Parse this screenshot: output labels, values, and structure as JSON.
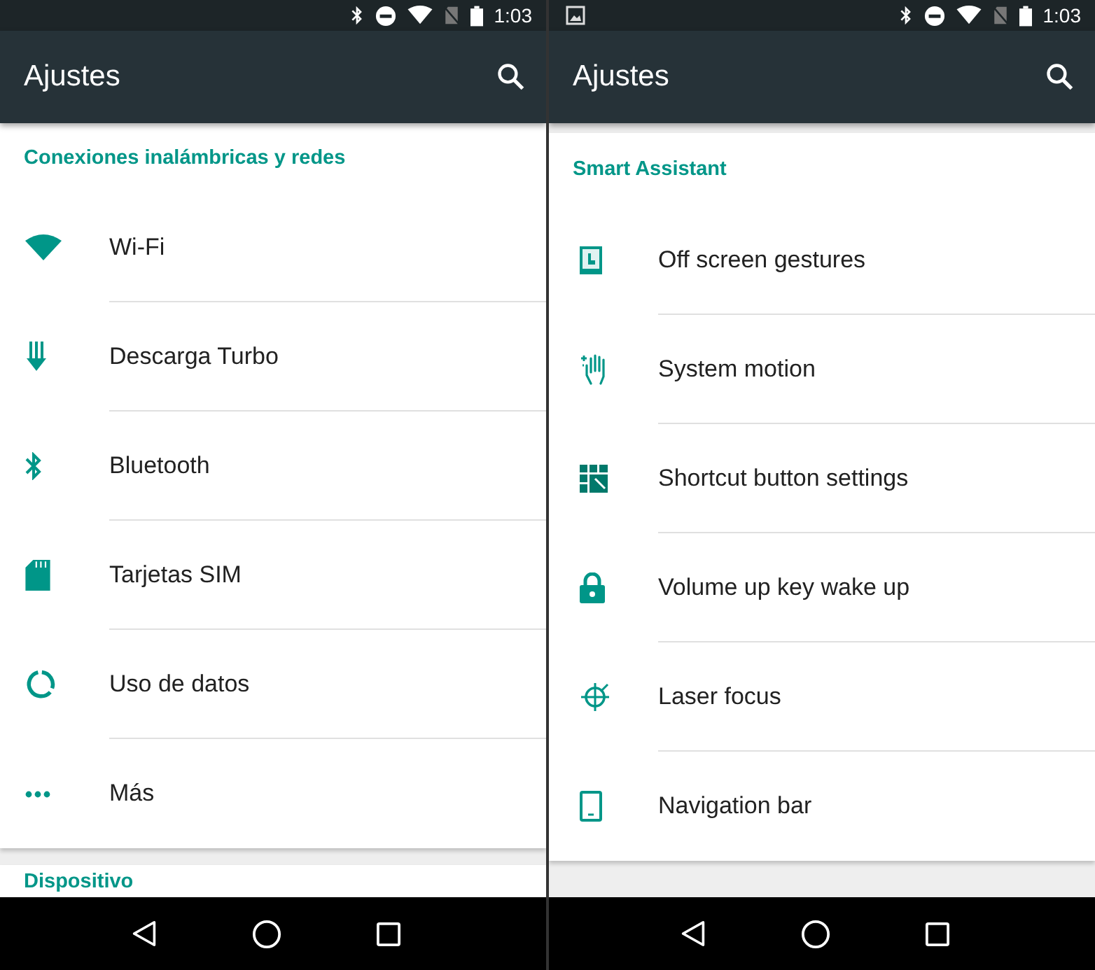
{
  "phones": [
    {
      "status_bar": {
        "notification_icon": false,
        "time": "1:03"
      },
      "app_bar": {
        "title": "Ajustes"
      },
      "sections": [
        {
          "header": "Conexiones inalámbricas y redes",
          "items": [
            {
              "kind": "wifi",
              "label": "Wi-Fi"
            },
            {
              "kind": "download",
              "label": "Descarga Turbo"
            },
            {
              "kind": "bluetooth",
              "label": "Bluetooth"
            },
            {
              "kind": "sim",
              "label": "Tarjetas SIM"
            },
            {
              "kind": "data",
              "label": "Uso de datos"
            },
            {
              "kind": "more",
              "label": "Más"
            }
          ]
        },
        {
          "header": "Dispositivo"
        }
      ]
    },
    {
      "status_bar": {
        "notification_icon": true,
        "time": "1:03"
      },
      "app_bar": {
        "title": "Ajustes"
      },
      "sections": [
        {
          "header": "Smart Assistant",
          "items": [
            {
              "kind": "gesture",
              "label": "Off screen gestures"
            },
            {
              "kind": "hand",
              "label": "System motion"
            },
            {
              "kind": "grid",
              "label": "Shortcut button settings"
            },
            {
              "kind": "lock",
              "label": "Volume up key wake up"
            },
            {
              "kind": "target",
              "label": "Laser focus"
            },
            {
              "kind": "phone",
              "label": "Navigation bar"
            }
          ]
        }
      ]
    }
  ]
}
